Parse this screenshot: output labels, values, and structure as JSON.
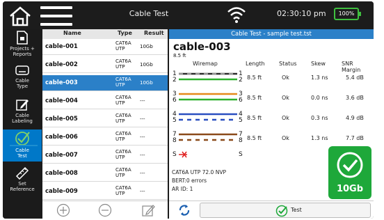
{
  "topbar": {
    "title": "Cable Test",
    "time": "02:30:10 pm",
    "battery": "100%"
  },
  "sidebar": {
    "items": [
      {
        "label": "Projects +\nReports",
        "icon": "document-icon"
      },
      {
        "label": "Cable\nType",
        "icon": "cable-type-icon"
      },
      {
        "label": "Cable\nLabeling",
        "icon": "edit-label-icon"
      },
      {
        "label": "Cable\nTest",
        "icon": "test-check-icon"
      },
      {
        "label": "Set\nReference",
        "icon": "ruler-icon"
      }
    ]
  },
  "list": {
    "headers": {
      "name": "Name",
      "type": "Type",
      "result": "Result"
    },
    "rows": [
      {
        "name": "cable-001",
        "type": "CAT6A\nUTP",
        "result": "10Gb"
      },
      {
        "name": "cable-002",
        "type": "CAT6A\nUTP",
        "result": "10Gb"
      },
      {
        "name": "cable-003",
        "type": "CAT6A\nUTP",
        "result": "10Gb"
      },
      {
        "name": "cable-004",
        "type": "CAT6A\nUTP",
        "result": "---"
      },
      {
        "name": "cable-005",
        "type": "CAT6A\nUTP",
        "result": "---"
      },
      {
        "name": "cable-006",
        "type": "CAT6A\nUTP",
        "result": "---"
      },
      {
        "name": "cable-007",
        "type": "CAT6A\nUTP",
        "result": "---"
      },
      {
        "name": "cable-008",
        "type": "CAT6A\nUTP",
        "result": "---"
      },
      {
        "name": "cable-009",
        "type": "CAT6A\nUTP",
        "result": "---"
      }
    ]
  },
  "detail": {
    "header": "Cable Test - sample test.tst",
    "cable_name": "cable-003",
    "cable_length": "8.5 ft",
    "columns": {
      "wiremap": "Wiremap",
      "length": "Length",
      "status": "Status",
      "skew": "Skew",
      "snr": "SNR Margin"
    },
    "pairs": [
      {
        "pins": [
          "1",
          "2"
        ],
        "length": "8.5 ft",
        "status": "Ok",
        "skew": "1.3 ns",
        "snr": "5.4 dB"
      },
      {
        "pins": [
          "3",
          "6"
        ],
        "length": "8.5 ft",
        "status": "Ok",
        "skew": "0.0 ns",
        "snr": "3.6 dB"
      },
      {
        "pins": [
          "4",
          "5"
        ],
        "length": "8.5 ft",
        "status": "Ok",
        "skew": "0.3 ns",
        "snr": "4.9 dB"
      },
      {
        "pins": [
          "7",
          "8"
        ],
        "length": "8.5 ft",
        "status": "Ok",
        "skew": "1.3 ns",
        "snr": "7.7 dB"
      }
    ],
    "shield": {
      "left": "S",
      "right": "S"
    },
    "info": {
      "line1": "CAT6A UTP  72.0 NVP",
      "line2": "BERT:0 errors",
      "line3": "AR ID: 1"
    },
    "badge": "10Gb",
    "test_label": "Test"
  },
  "colors": {
    "accent": "#2b80c8",
    "pass": "#1ea83a",
    "selected_tool": "#0078c8"
  }
}
